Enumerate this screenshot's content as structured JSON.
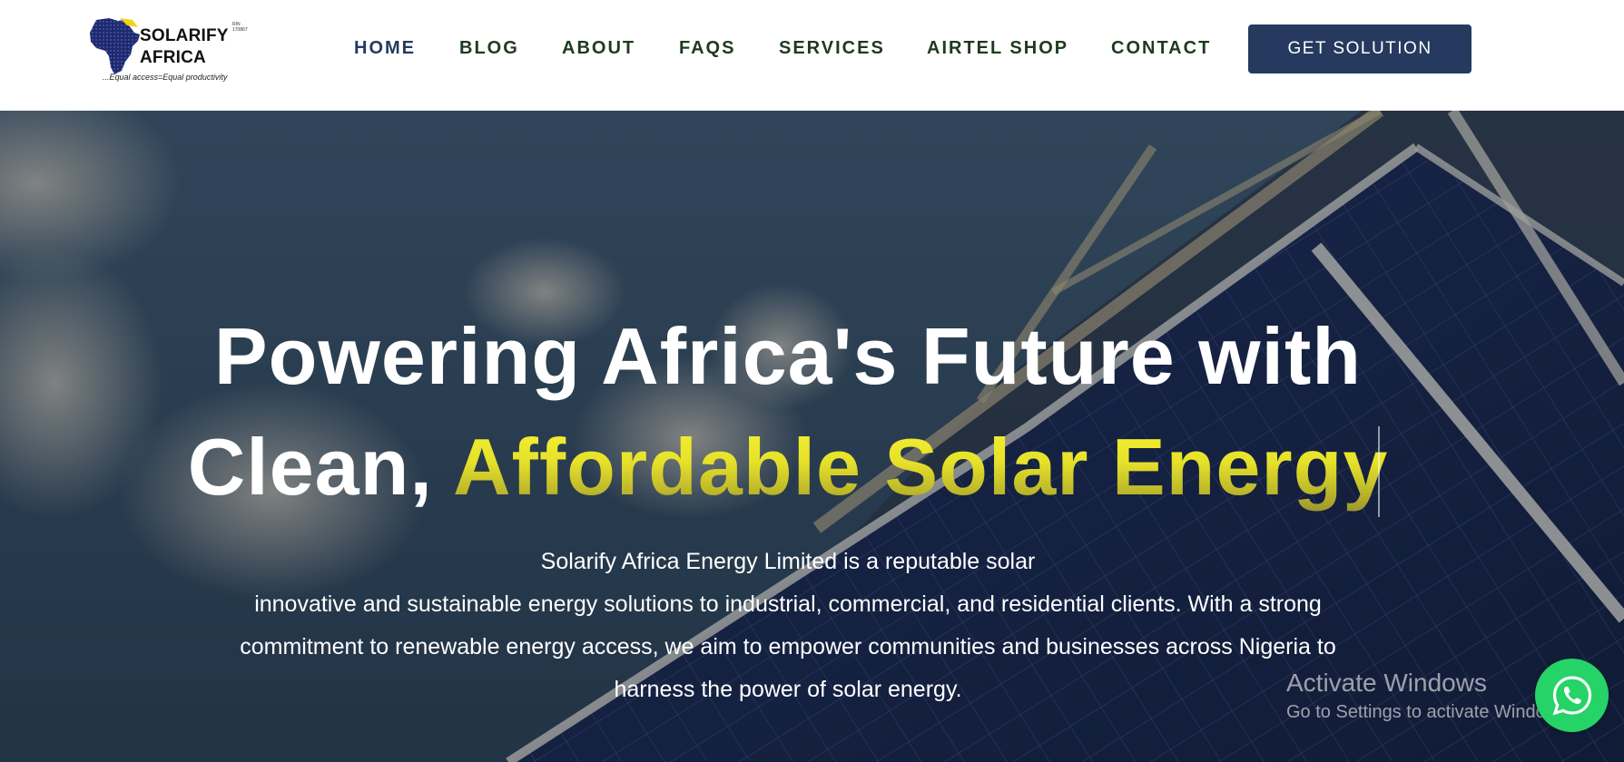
{
  "logo": {
    "name_line1": "SOLARIFY",
    "name_line2": "AFRICA",
    "reg_no": "RIN 170867",
    "tagline": "...Equal access=Equal productivity"
  },
  "nav": {
    "items": [
      "HOME",
      "BLOG",
      "ABOUT",
      "FAQS",
      "SERVICES",
      "AIRTEL SHOP",
      "CONTACT"
    ],
    "active": "HOME"
  },
  "cta": {
    "label": "GET SOLUTION"
  },
  "hero": {
    "title_line1": "Powering Africa's Future with",
    "title_line2_plain": "Clean, ",
    "title_line2_accent": "Affordable Solar Energy",
    "text_lines": [
      "Solarify Africa Energy Limited is a reputable solar",
      "innovative and sustainable energy solutions to industrial, commercial, and residential clients. With a strong",
      "commitment to renewable energy access, we aim to empower communities and businesses across Nigeria to",
      "harness the power of solar energy."
    ]
  },
  "watermark": {
    "title": "Activate Windows",
    "subtitle": "Go to Settings to activate Windows."
  },
  "icons": {
    "whatsapp": "whatsapp-icon",
    "logo_map": "africa-map-icon"
  },
  "colors": {
    "primary": "#253a5e",
    "nav_text": "#1f3a1f",
    "accent_yellow": "#e6e12a",
    "whatsapp_green": "#25d366"
  }
}
